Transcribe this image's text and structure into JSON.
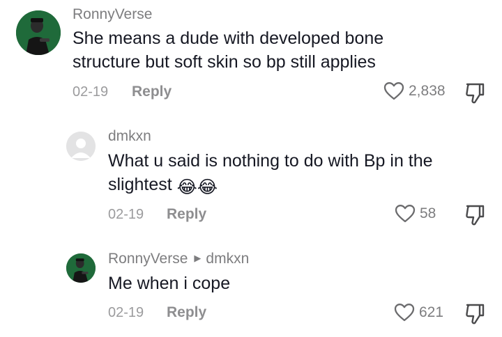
{
  "comments": [
    {
      "username": "RonnyVerse",
      "text": "She means a dude with developed bone structure but soft skin so bp still applies",
      "date": "02-19",
      "reply_label": "Reply",
      "likes": "2,838",
      "avatar": "profile-photo"
    },
    {
      "username": "dmkxn",
      "text": "What u said is nothing to do with Bp in the slightest",
      "emojis": [
        "😂",
        "😂"
      ],
      "date": "02-19",
      "reply_label": "Reply",
      "likes": "58",
      "avatar": "default-avatar"
    },
    {
      "username": "RonnyVerse",
      "reply_to": "dmkxn",
      "text": "Me when i cope",
      "date": "02-19",
      "reply_label": "Reply",
      "likes": "621",
      "avatar": "profile-photo"
    }
  ],
  "icons": {
    "like": "heart-outline-icon",
    "dislike": "thumbs-down-icon",
    "reply_arrow": "caret-right-icon",
    "emoji": "face-with-tears-of-joy"
  },
  "colors": {
    "username": "#7d7d7f",
    "text": "#161823",
    "meta": "#9b9b9d",
    "avatar_bg": "#1f6a3a"
  }
}
